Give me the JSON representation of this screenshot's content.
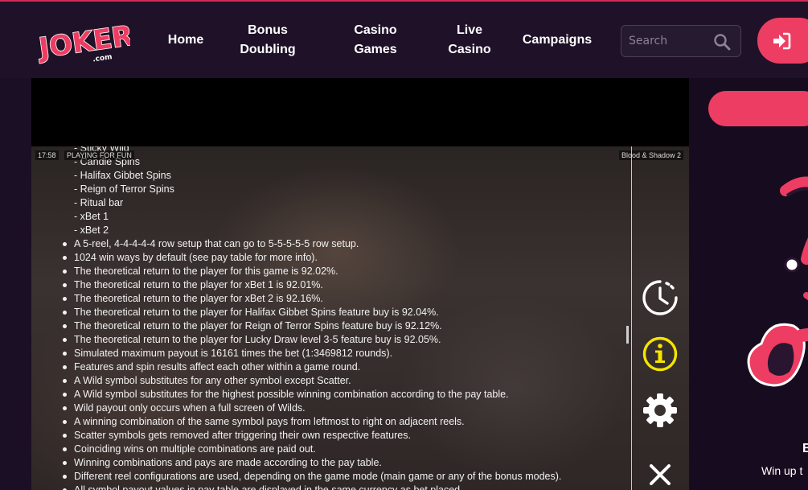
{
  "header": {
    "logo_text": "JOKERI",
    "logo_sub": ".com",
    "nav": [
      {
        "line1": "Home",
        "line2": ""
      },
      {
        "line1": "Bonus",
        "line2": "Doubling"
      },
      {
        "line1": "Casino",
        "line2": "Games"
      },
      {
        "line1": "Live",
        "line2": "Casino"
      },
      {
        "line1": "Campaigns",
        "line2": ""
      }
    ],
    "search_placeholder": "Search",
    "login_icon": "sign-in-icon"
  },
  "game": {
    "time": "17:58",
    "mode": "PLAYING FOR FUN",
    "title": "Blood & Shadow 2",
    "lines_plain": [
      "- Sticky Wild",
      "- Candle Spins",
      "- Halifax Gibbet Spins",
      "- Reign of Terror Spins",
      "- Ritual bar",
      "- xBet 1",
      "- xBet 2"
    ],
    "lines_bullet": [
      "A 5-reel, 4-4-4-4-4 row setup that can go to 5-5-5-5-5 row setup.",
      "1024 win ways by default (see pay table for more info).",
      "The theoretical return to the player for this game is 92.02%.",
      "The theoretical return to the player for xBet 1 is 92.01%.",
      "The theoretical return to the player for xBet 2 is 92.16%.",
      "The theoretical return to the player for Halifax Gibbet Spins feature buy is 92.04%.",
      "The theoretical return to the player for Reign of Terror Spins feature buy is 92.12%.",
      "The theoretical return to the player for Lucky Draw level 3-5 feature buy is 92.05%.",
      "Simulated maximum payout is 16161 times the bet (1:3469812 rounds).",
      "Features and spin results affect each other within a game round.",
      "A Wild symbol substitutes for any other symbol except Scatter.",
      "A Wild symbol substitutes for the highest possible winning combination according to the pay table.",
      "Wild payout only occurs when a full screen of Wilds.",
      "A winning combination of the same symbol pays from leftmost to right on adjacent reels.",
      "Scatter symbols gets removed after triggering their own respective features.",
      "Coinciding wins on multiple combinations are paid out.",
      "Winning combinations and pays are made according to the pay table.",
      "Different reel configurations are used, depending on the game mode (main game or any of the bonus modes).",
      "All symbol payout values in pay table are displayed in the same currency as bet placed."
    ],
    "side_icons": [
      "history-icon",
      "info-icon",
      "settings-icon",
      "close-icon"
    ]
  },
  "promo": {
    "title": "B",
    "subtitle": "Win up t"
  },
  "colors": {
    "accent": "#ee3d62",
    "header_bg": "#1e1128",
    "info_yellow": "#f5e400"
  }
}
